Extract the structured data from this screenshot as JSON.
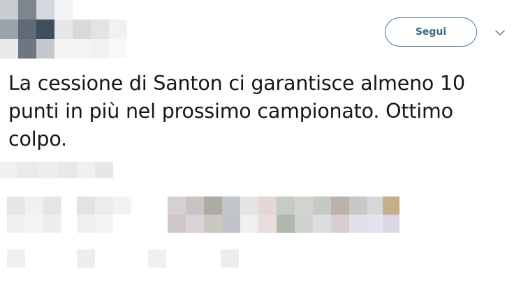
{
  "tweet": {
    "text": "La cessione di Santon ci garantisce almeno 10 punti in più nel prossimo campionato. Ottimo colpo."
  },
  "actions": {
    "follow_label": "Segui",
    "more_icon": "chevron-down-icon"
  },
  "colors": {
    "follow_border": "#4a7796",
    "follow_text": "#3c6782",
    "text": "#14171a"
  }
}
